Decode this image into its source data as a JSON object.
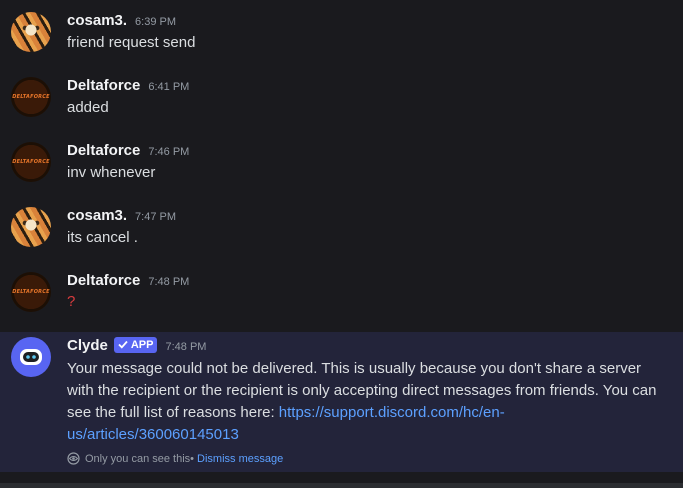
{
  "messages": [
    {
      "author": "cosam3.",
      "time": "6:39 PM",
      "text": "friend request send",
      "avatar": "tiger-avatar"
    },
    {
      "author": "Deltaforce",
      "time": "6:41 PM",
      "text": "added",
      "avatar": "deltaforce-logo"
    },
    {
      "author": "Deltaforce",
      "time": "7:46 PM",
      "text": "inv whenever",
      "avatar": "deltaforce-logo"
    },
    {
      "author": "cosam3.",
      "time": "7:47 PM",
      "text": "its cancel .",
      "avatar": "tiger-avatar"
    },
    {
      "author": "Deltaforce",
      "time": "7:48 PM",
      "text": "?",
      "avatar": "deltaforce-logo"
    }
  ],
  "avatar_logo_text": "DELTAFORCE",
  "clyde": {
    "author": "Clyde",
    "badge": "APP",
    "time": "7:48 PM",
    "text": "Your message could not be delivered. This is usually because you don't share a server with the recipient or the recipient is only accepting direct messages from friends. You can see the full list of reasons here: ",
    "link": "https://support.discord.com/hc/en-us/articles/360060145013",
    "ephemeral_note": "Only you can see this",
    "separator": " • ",
    "dismiss_label": "Dismiss message"
  },
  "colors": {
    "background": "#1a1a1e",
    "clyde_highlight": "#23243a",
    "blurple": "#5865f2",
    "link": "#5ca0ff",
    "question_mark": "#d83c3e"
  }
}
